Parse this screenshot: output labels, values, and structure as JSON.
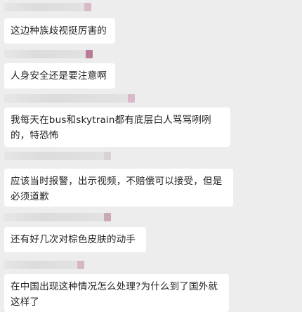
{
  "colors": {
    "background": "#ededed",
    "bubble": "#ffffff",
    "text": "#222222"
  },
  "messages": [
    {
      "text": "这边种族歧视挺厉害的",
      "sender_tag_color": "#d9b9c9"
    },
    {
      "text": "人身安全还是要注意啊",
      "sender_tag_color": "#b97c98"
    },
    {
      "text": "我每天在bus和skytrain都有底层白人骂骂咧咧的，特恐怖",
      "sender_tag_color": "#d9b9c9"
    },
    {
      "text": "应该当时报警，出示视频，不赔偿可以接受，但是必须道歉",
      "sender_tag_color": "#d8d2d4"
    },
    {
      "text": "还有好几次对棕色皮肤的动手",
      "sender_tag_color": "#c9a9b6"
    },
    {
      "text": "在中国出现这种情况怎么处理?为什么到了国外就这样了",
      "sender_tag_color": "#d8b7c4"
    }
  ]
}
